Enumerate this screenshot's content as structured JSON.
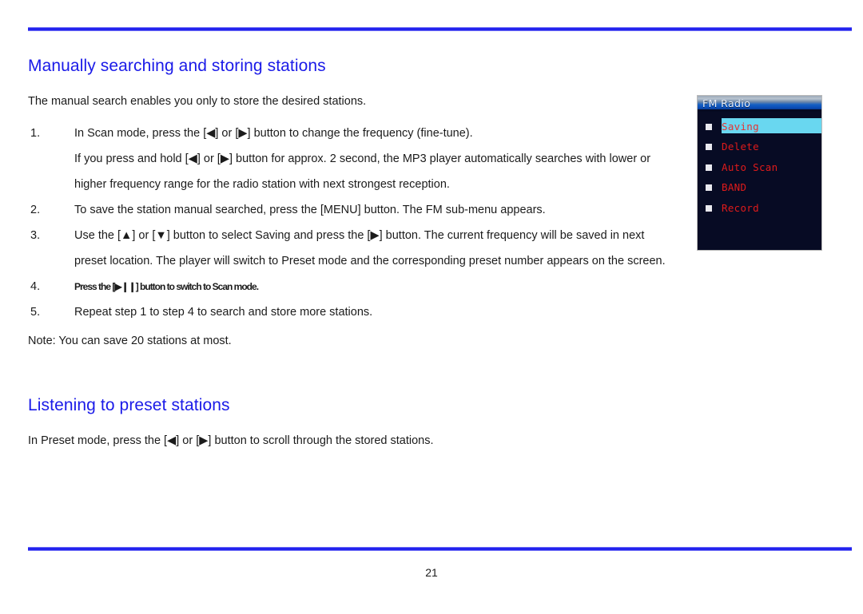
{
  "document": {
    "page_number": "21",
    "accent_color": "#2222ee",
    "heading_color": "#1a1ae8"
  },
  "sections": [
    {
      "heading": "Manually searching and storing stations",
      "lead": "The manual search enables you only to store the desired stations.",
      "steps": [
        {
          "number": "1.",
          "lines": [
            "In Scan mode, press the [◀] or [▶] button to change the frequency (fine-tune).",
            "If you press and hold [◀] or [▶] button for approx. 2 second, the MP3 player automatically searches with lower or",
            "higher frequency range for the radio station with next strongest reception."
          ]
        },
        {
          "number": "2.",
          "lines": [
            "To save the station manual searched, press the [MENU] button. The FM sub-menu appears."
          ]
        },
        {
          "number": "3.",
          "lines": [
            "Use the [▲] or [▼] button to select Saving and press the [▶] button. The current frequency will be saved in next",
            "preset location. The player will switch to Preset mode and the corresponding preset number appears on the screen."
          ]
        },
        {
          "number": "4.",
          "lines": [
            "Press the [▶❙❙] button to switch to Scan mode."
          ]
        },
        {
          "number": "5.",
          "lines": [
            "Repeat step 1 to step 4 to search and store more stations."
          ]
        }
      ],
      "note": "Note: You can save 20 stations at most."
    },
    {
      "heading": "Listening to preset stations",
      "lead": "In Preset mode, press the [◀] or [▶] button to scroll through the stored stations."
    }
  ],
  "device_screen": {
    "title": "FM Radio",
    "background_color": "#070b24",
    "item_text_color": "#e01b1b",
    "highlight_color": "#69d7f0",
    "items": [
      {
        "label": "Saving",
        "selected": true
      },
      {
        "label": "Delete",
        "selected": false
      },
      {
        "label": "Auto Scan",
        "selected": false
      },
      {
        "label": "BAND",
        "selected": false
      },
      {
        "label": "Record",
        "selected": false
      }
    ]
  }
}
